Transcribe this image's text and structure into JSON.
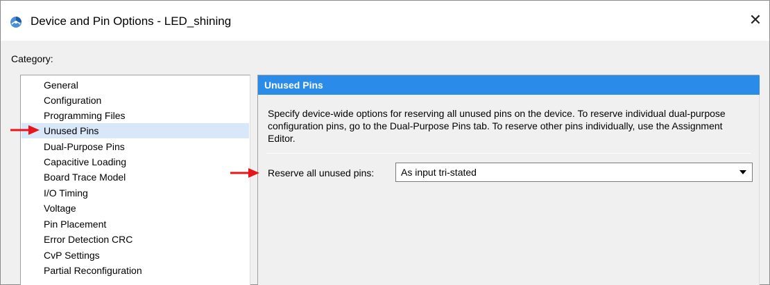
{
  "window": {
    "title": "Device and Pin Options - LED_shining",
    "close_glyph": "✕"
  },
  "category": {
    "label": "Category:",
    "items": [
      {
        "label": "General"
      },
      {
        "label": "Configuration"
      },
      {
        "label": "Programming Files"
      },
      {
        "label": "Unused Pins",
        "selected": true
      },
      {
        "label": "Dual-Purpose Pins"
      },
      {
        "label": "Capacitive Loading"
      },
      {
        "label": "Board Trace Model"
      },
      {
        "label": "I/O Timing"
      },
      {
        "label": "Voltage"
      },
      {
        "label": "Pin Placement"
      },
      {
        "label": "Error Detection CRC"
      },
      {
        "label": "CvP Settings"
      },
      {
        "label": "Partial Reconfiguration"
      }
    ]
  },
  "panel": {
    "header": "Unused Pins",
    "description": "Specify device-wide options for reserving all unused pins on the device. To reserve individual dual-purpose configuration pins, go to the Dual-Purpose Pins tab. To reserve other pins individually, use the Assignment Editor.",
    "reserve_label": "Reserve all unused pins:",
    "reserve_value": "As input tri-stated"
  },
  "colors": {
    "header_blue": "#2b8be8",
    "selection": "#d9e8f8",
    "annotation_red": "#e8141b"
  },
  "icons": {
    "app": "quartus-app-icon",
    "close": "close-icon",
    "dropdown": "chevron-down-icon",
    "annotation": "red-arrow-icon"
  }
}
